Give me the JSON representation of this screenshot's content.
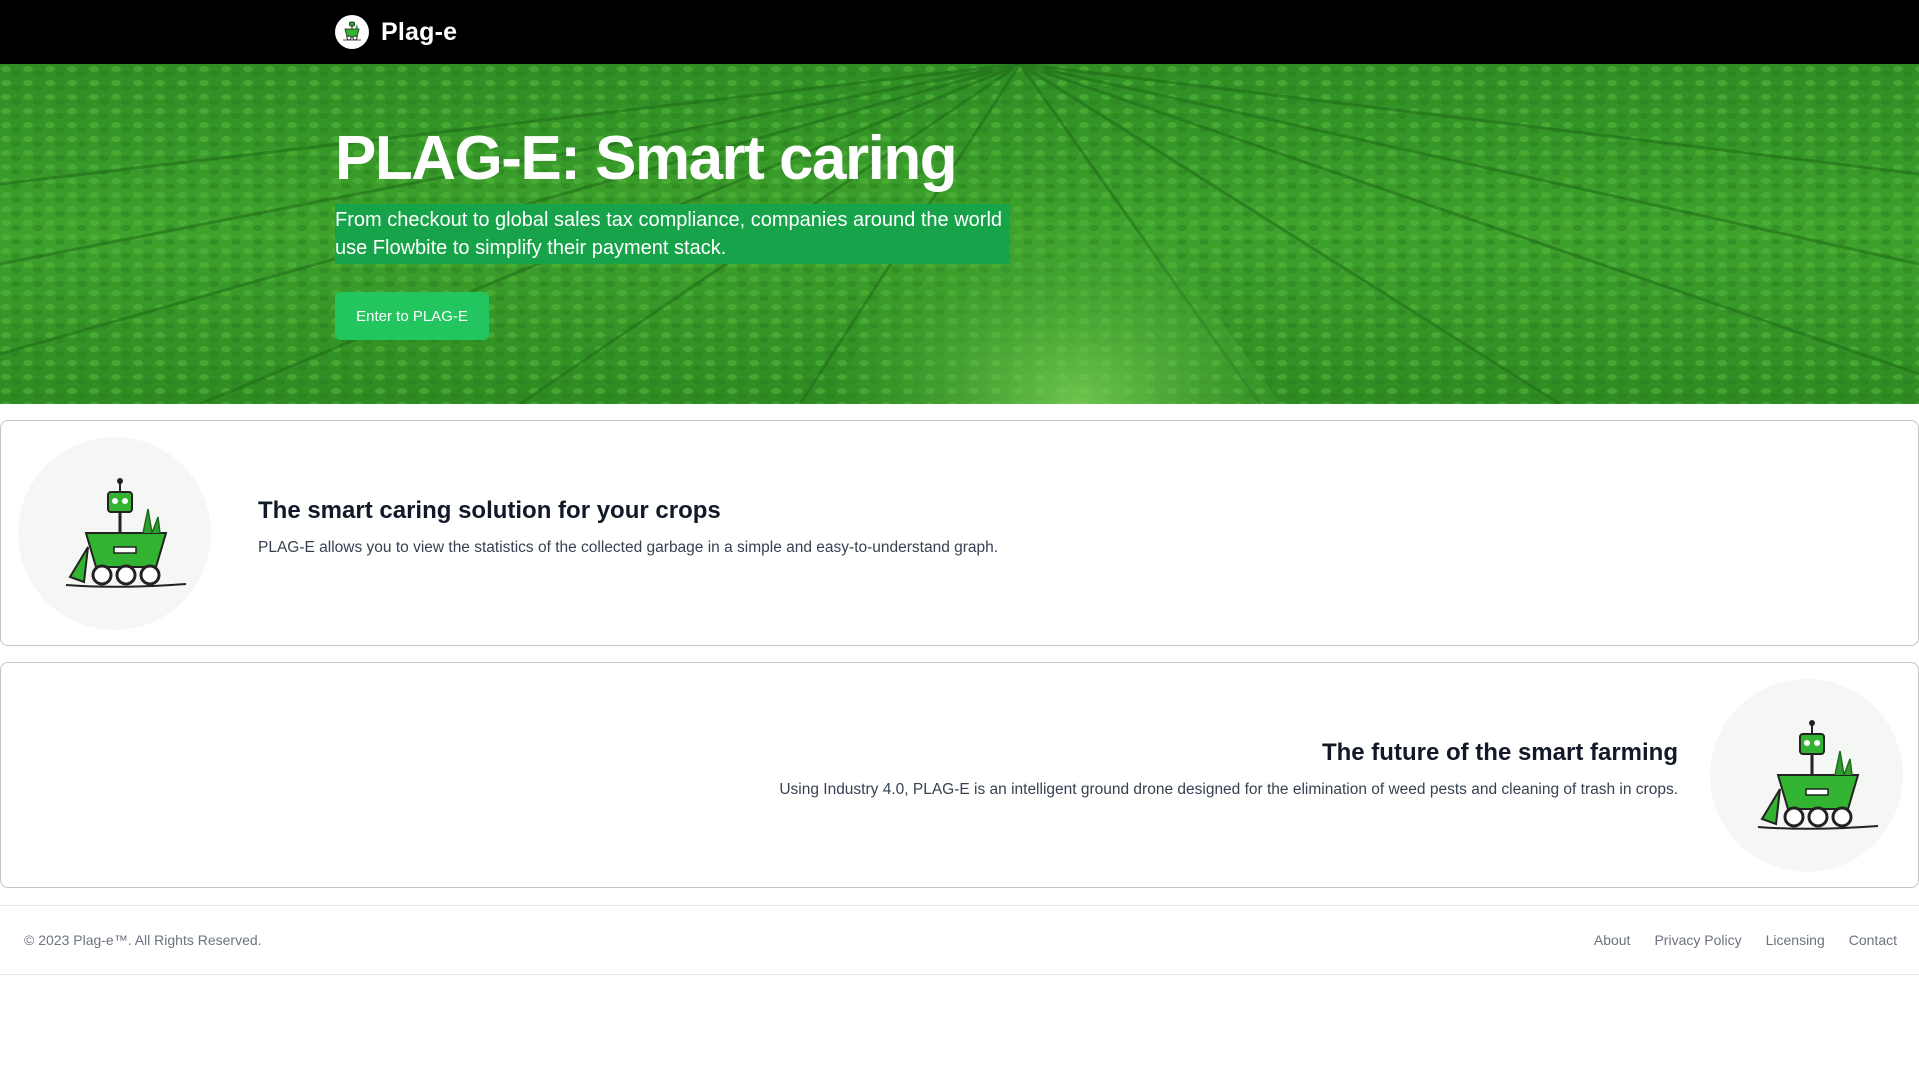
{
  "navbar": {
    "brand_name": "Plag-e",
    "logo_icon": "robot-cart-icon"
  },
  "hero": {
    "title": "PLAG-E: Smart caring",
    "subtitle": "From checkout to global sales tax compliance, companies around the world use Flowbite to simplify their payment stack.",
    "cta_label": "Enter to PLAG-E",
    "background": "crop-field-image"
  },
  "features": [
    {
      "title": "The smart caring solution for your crops",
      "text": "PLAG-E allows you to view the statistics of the collected garbage in a simple and easy-to-understand graph.",
      "image_icon": "robot-cart-icon"
    },
    {
      "title": "The future of the smart farming",
      "text": "Using Industry 4.0, PLAG-E is an intelligent ground drone designed for the elimination of weed pests and cleaning of trash in crops.",
      "image_icon": "robot-cart-icon"
    }
  ],
  "footer": {
    "copyright": "© 2023 Plag-e™. All Rights Reserved.",
    "links": [
      "About",
      "Privacy Policy",
      "Licensing",
      "Contact"
    ]
  },
  "colors": {
    "navbar_bg": "#000000",
    "accent_green": "#22c55e",
    "subtitle_highlight": "#16a34a"
  }
}
